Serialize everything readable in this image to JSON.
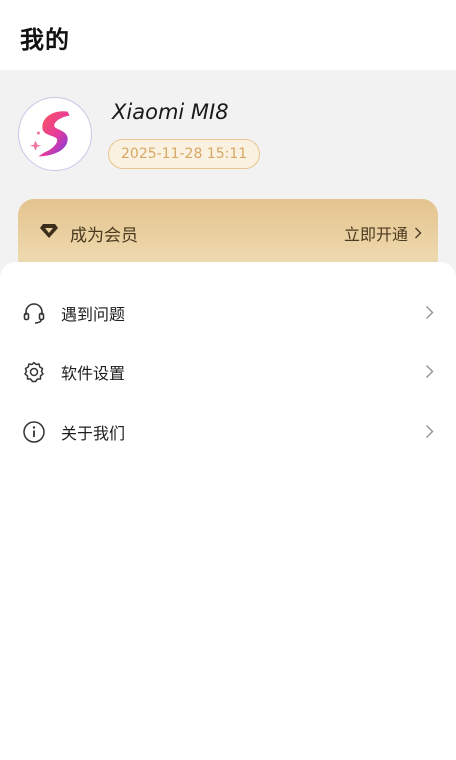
{
  "header": {
    "title": "我的"
  },
  "profile": {
    "device_name": "Xiaomi MI8",
    "date": "2025-11-28 15:11",
    "avatar_icon": "lightning-s-logo"
  },
  "vip": {
    "icon": "diamond-icon",
    "label": "成为会员",
    "action": "立即开通",
    "colors": {
      "gold": "#e3c48e",
      "text": "#4a3a20"
    }
  },
  "menu": {
    "items": [
      {
        "icon": "headset-icon",
        "label": "遇到问题"
      },
      {
        "icon": "gear-icon",
        "label": "软件设置"
      },
      {
        "icon": "info-icon",
        "label": "关于我们"
      }
    ]
  }
}
